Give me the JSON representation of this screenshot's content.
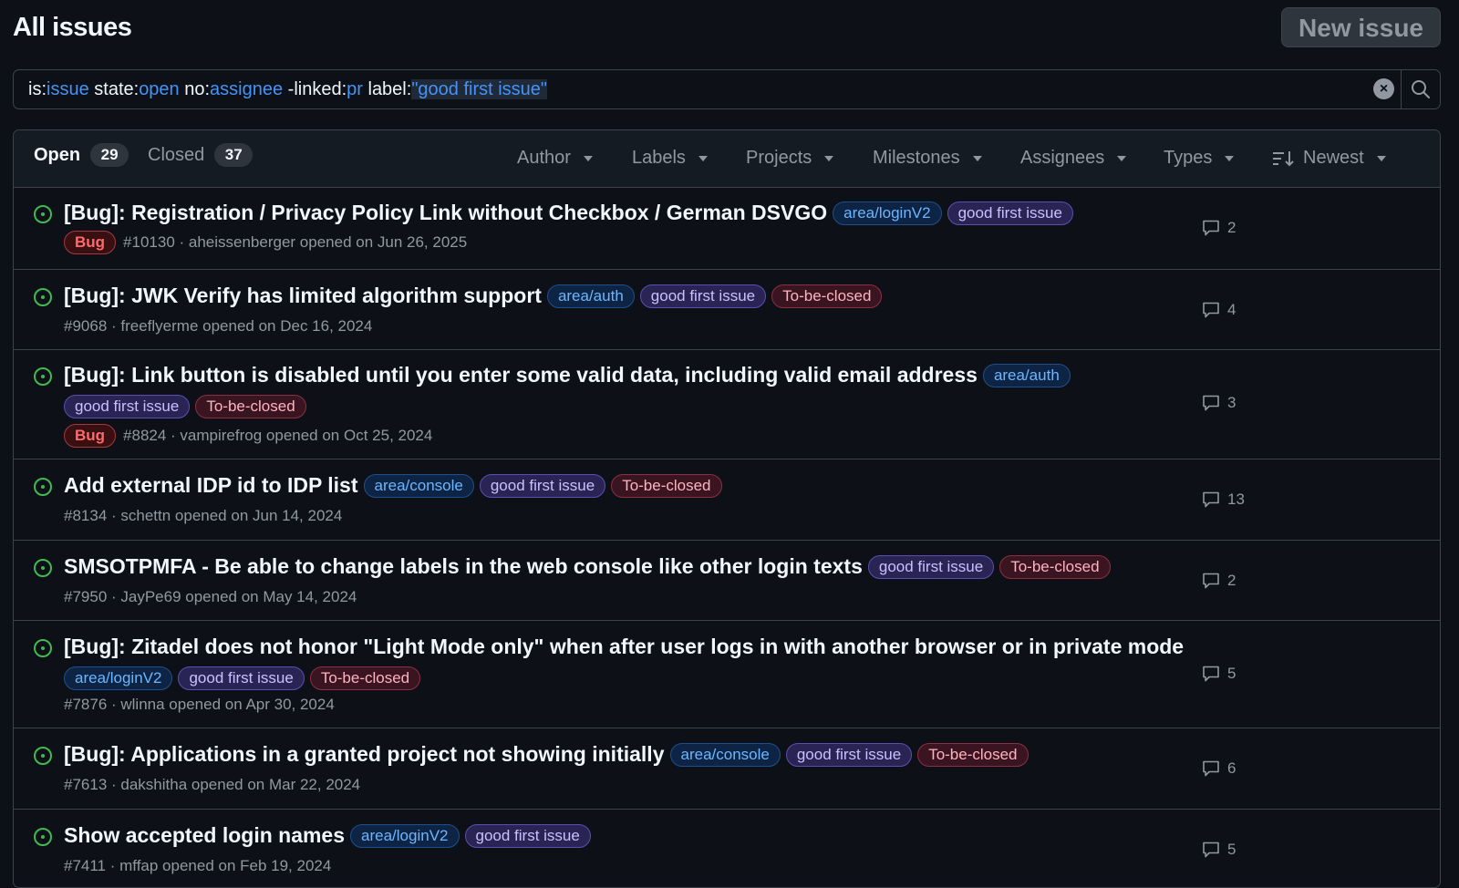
{
  "header": {
    "title": "All issues",
    "new_issue_label": "New issue"
  },
  "search": {
    "tokens": [
      {
        "key": "is:",
        "val": "issue"
      },
      {
        "key": " state:",
        "val": "open"
      },
      {
        "key": " no:",
        "val": "assignee"
      },
      {
        "key": " -linked:",
        "val": "pr"
      },
      {
        "key": " label:",
        "val": "\"good first issue\""
      }
    ]
  },
  "tabs": {
    "open_label": "Open",
    "open_count": "29",
    "closed_label": "Closed",
    "closed_count": "37"
  },
  "filters": {
    "author": "Author",
    "labels": "Labels",
    "projects": "Projects",
    "milestones": "Milestones",
    "assignees": "Assignees",
    "types": "Types",
    "sort": "Newest"
  },
  "issues": [
    {
      "title": "[Bug]: Registration / Privacy Policy Link without Checkbox / German DSVGO",
      "inline_labels": [
        {
          "text": "area/loginV2",
          "kind": "area"
        },
        {
          "text": "good first issue",
          "kind": "gfi"
        }
      ],
      "extra_labels": [],
      "type": "Bug",
      "meta": "#10130 · aheissenberger opened on Jun 26, 2025",
      "comments": "2"
    },
    {
      "title": "[Bug]: JWK Verify has limited algorithm support",
      "inline_labels": [
        {
          "text": "area/auth",
          "kind": "area"
        },
        {
          "text": "good first issue",
          "kind": "gfi"
        },
        {
          "text": "To-be-closed",
          "kind": "tbc"
        }
      ],
      "extra_labels": [],
      "type": "",
      "meta": "#9068 · freeflyerme opened on Dec 16, 2024",
      "comments": "4"
    },
    {
      "title": "[Bug]: Link button is disabled until you enter some valid data, including valid email address",
      "inline_labels": [
        {
          "text": "area/auth",
          "kind": "area"
        }
      ],
      "extra_labels": [
        {
          "text": "good first issue",
          "kind": "gfi"
        },
        {
          "text": "To-be-closed",
          "kind": "tbc"
        }
      ],
      "type": "Bug",
      "meta": "#8824 · vampirefrog opened on Oct 25, 2024",
      "comments": "3"
    },
    {
      "title": "Add external IDP id to IDP list",
      "inline_labels": [
        {
          "text": "area/console",
          "kind": "area"
        },
        {
          "text": "good first issue",
          "kind": "gfi"
        },
        {
          "text": "To-be-closed",
          "kind": "tbc"
        }
      ],
      "extra_labels": [],
      "type": "",
      "meta": "#8134 · schettn opened on Jun 14, 2024",
      "comments": "13"
    },
    {
      "title": "SMSOTPMFA - Be able to change labels in the web console like other login texts",
      "inline_labels": [
        {
          "text": "good first issue",
          "kind": "gfi"
        },
        {
          "text": "To-be-closed",
          "kind": "tbc"
        }
      ],
      "extra_labels": [],
      "type": "",
      "meta": "#7950 · JayPe69 opened on May 14, 2024",
      "comments": "2"
    },
    {
      "title": "[Bug]: Zitadel does not honor \"Light Mode only\" when after user logs in with another browser or in private mode",
      "inline_labels": [],
      "extra_labels": [
        {
          "text": "area/loginV2",
          "kind": "area"
        },
        {
          "text": "good first issue",
          "kind": "gfi"
        },
        {
          "text": "To-be-closed",
          "kind": "tbc"
        }
      ],
      "type": "",
      "meta": "#7876 · wlinna opened on Apr 30, 2024",
      "comments": "5"
    },
    {
      "title": "[Bug]: Applications in a granted project not showing initially",
      "inline_labels": [
        {
          "text": "area/console",
          "kind": "area"
        },
        {
          "text": "good first issue",
          "kind": "gfi"
        },
        {
          "text": "To-be-closed",
          "kind": "tbc"
        }
      ],
      "extra_labels": [],
      "type": "",
      "meta": "#7613 · dakshitha opened on Mar 22, 2024",
      "comments": "6"
    },
    {
      "title": "Show accepted login names",
      "inline_labels": [
        {
          "text": "area/loginV2",
          "kind": "area"
        },
        {
          "text": "good first issue",
          "kind": "gfi"
        }
      ],
      "extra_labels": [],
      "type": "",
      "meta": "#7411 · mffap opened on Feb 19, 2024",
      "comments": "5"
    }
  ]
}
